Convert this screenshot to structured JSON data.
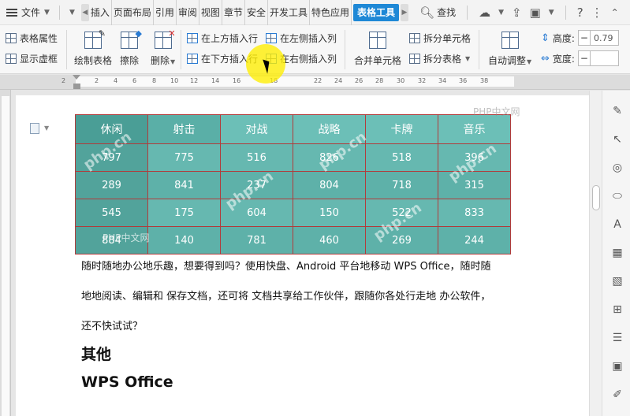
{
  "menubar": {
    "file_label": "文件",
    "tabs": [
      {
        "label": "插入"
      },
      {
        "label": "页面布局"
      },
      {
        "label": "引用"
      },
      {
        "label": "审阅"
      },
      {
        "label": "视图"
      },
      {
        "label": "章节"
      },
      {
        "label": "安全"
      },
      {
        "label": "开发工具"
      },
      {
        "label": "特色应用"
      },
      {
        "label": "表格工具",
        "active": true
      }
    ],
    "search_label": "查找",
    "help_icon": "?"
  },
  "ribbon": {
    "table_props": "表格属性",
    "show_gridlines": "显示虚框",
    "draw_table": "绘制表格",
    "eraser": "擦除",
    "delete": "删除",
    "insert_above": "在上方插入行",
    "insert_below": "在下方插入行",
    "insert_left": "在左侧插入列",
    "insert_right": "在右侧插入列",
    "merge_cells": "合并单元格",
    "split_cells": "拆分单元格",
    "split_table": "拆分表格",
    "auto_fit": "自动调整",
    "height_label": "高度:",
    "height_value": "0.79",
    "width_label": "宽度:",
    "width_value": ""
  },
  "ruler": {
    "labels": [
      "2",
      "2",
      "4",
      "6",
      "8",
      "10",
      "12",
      "14",
      "16",
      "18",
      "22",
      "24",
      "26",
      "28",
      "30",
      "32",
      "34",
      "36",
      "38"
    ]
  },
  "table": {
    "headers": [
      "休闲",
      "射击",
      "对战",
      "战略",
      "卡牌",
      "音乐"
    ],
    "rows": [
      [
        "797",
        "775",
        "516",
        "826",
        "518",
        "396"
      ],
      [
        "289",
        "841",
        "237",
        "804",
        "718",
        "315"
      ],
      [
        "545",
        "175",
        "604",
        "150",
        "522",
        "833"
      ],
      [
        "884",
        "140",
        "781",
        "460",
        "269",
        "244"
      ]
    ]
  },
  "document": {
    "para1": "随时随地办公地乐趣，想要得到吗？使用快盘、Android 平台地移动 WPS Office，随时随",
    "para2": "地地阅读、编辑和  保存文档，还可将  文档共享给工作伙伴，跟随你各处行走地  办公软件，",
    "para3": "还不快试试？",
    "heading1": "其他",
    "heading2": "WPS Office"
  },
  "watermark": {
    "text": "php.cn",
    "text_cn": "PHP中文网"
  },
  "colors": {
    "accent": "#1e88d6",
    "table_teal": "#66b8b0",
    "table_border": "#b13b3b",
    "cursor_highlight": "#ffee00"
  }
}
